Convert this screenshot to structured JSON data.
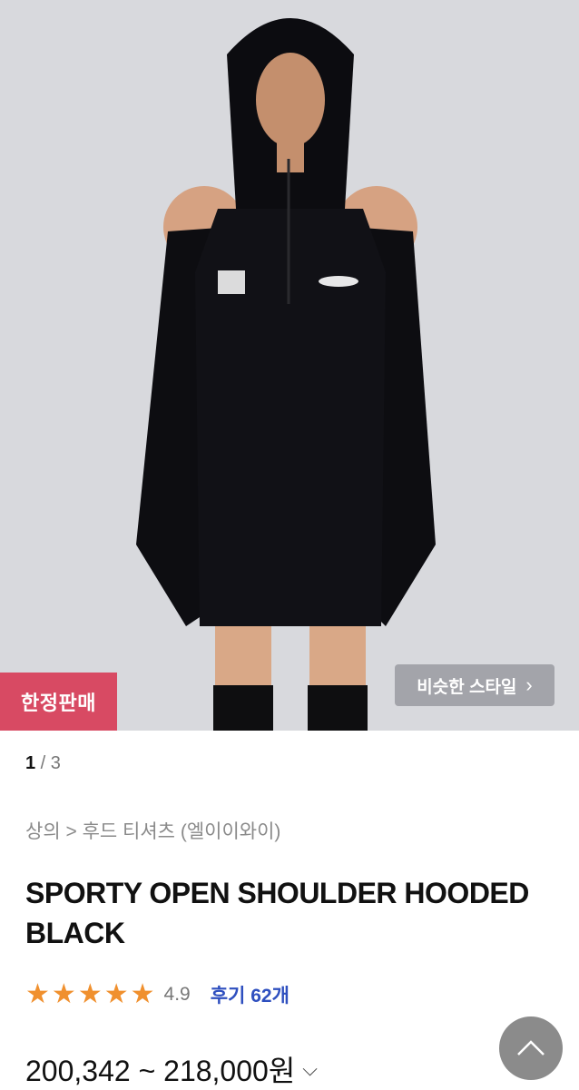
{
  "hero": {
    "badge_label": "한정판매",
    "similar_style_label": "비슷한 스타일",
    "similar_style_chevron": "chevron-right-icon"
  },
  "pager": {
    "current": "1",
    "separator": " / ",
    "total": "3"
  },
  "breadcrumb": "상의 > 후드 티셔츠 (엘이이와이)",
  "product": {
    "title": "SPORTY OPEN SHOULDER HOODED BLACK",
    "rating": {
      "stars": 5,
      "score": "4.9",
      "reviews_label": "후기 62개"
    },
    "price_range": "200,342 ~ 218,000원",
    "price_caret_icon": "chevron-down-icon"
  },
  "colors": {
    "badge_bg": "#d84a63",
    "star": "#f0902e",
    "review_link": "#2e4fbf",
    "background": "#d7d8dc"
  },
  "icons": {
    "scroll_top": "chevron-up-icon",
    "star": "star-icon"
  }
}
